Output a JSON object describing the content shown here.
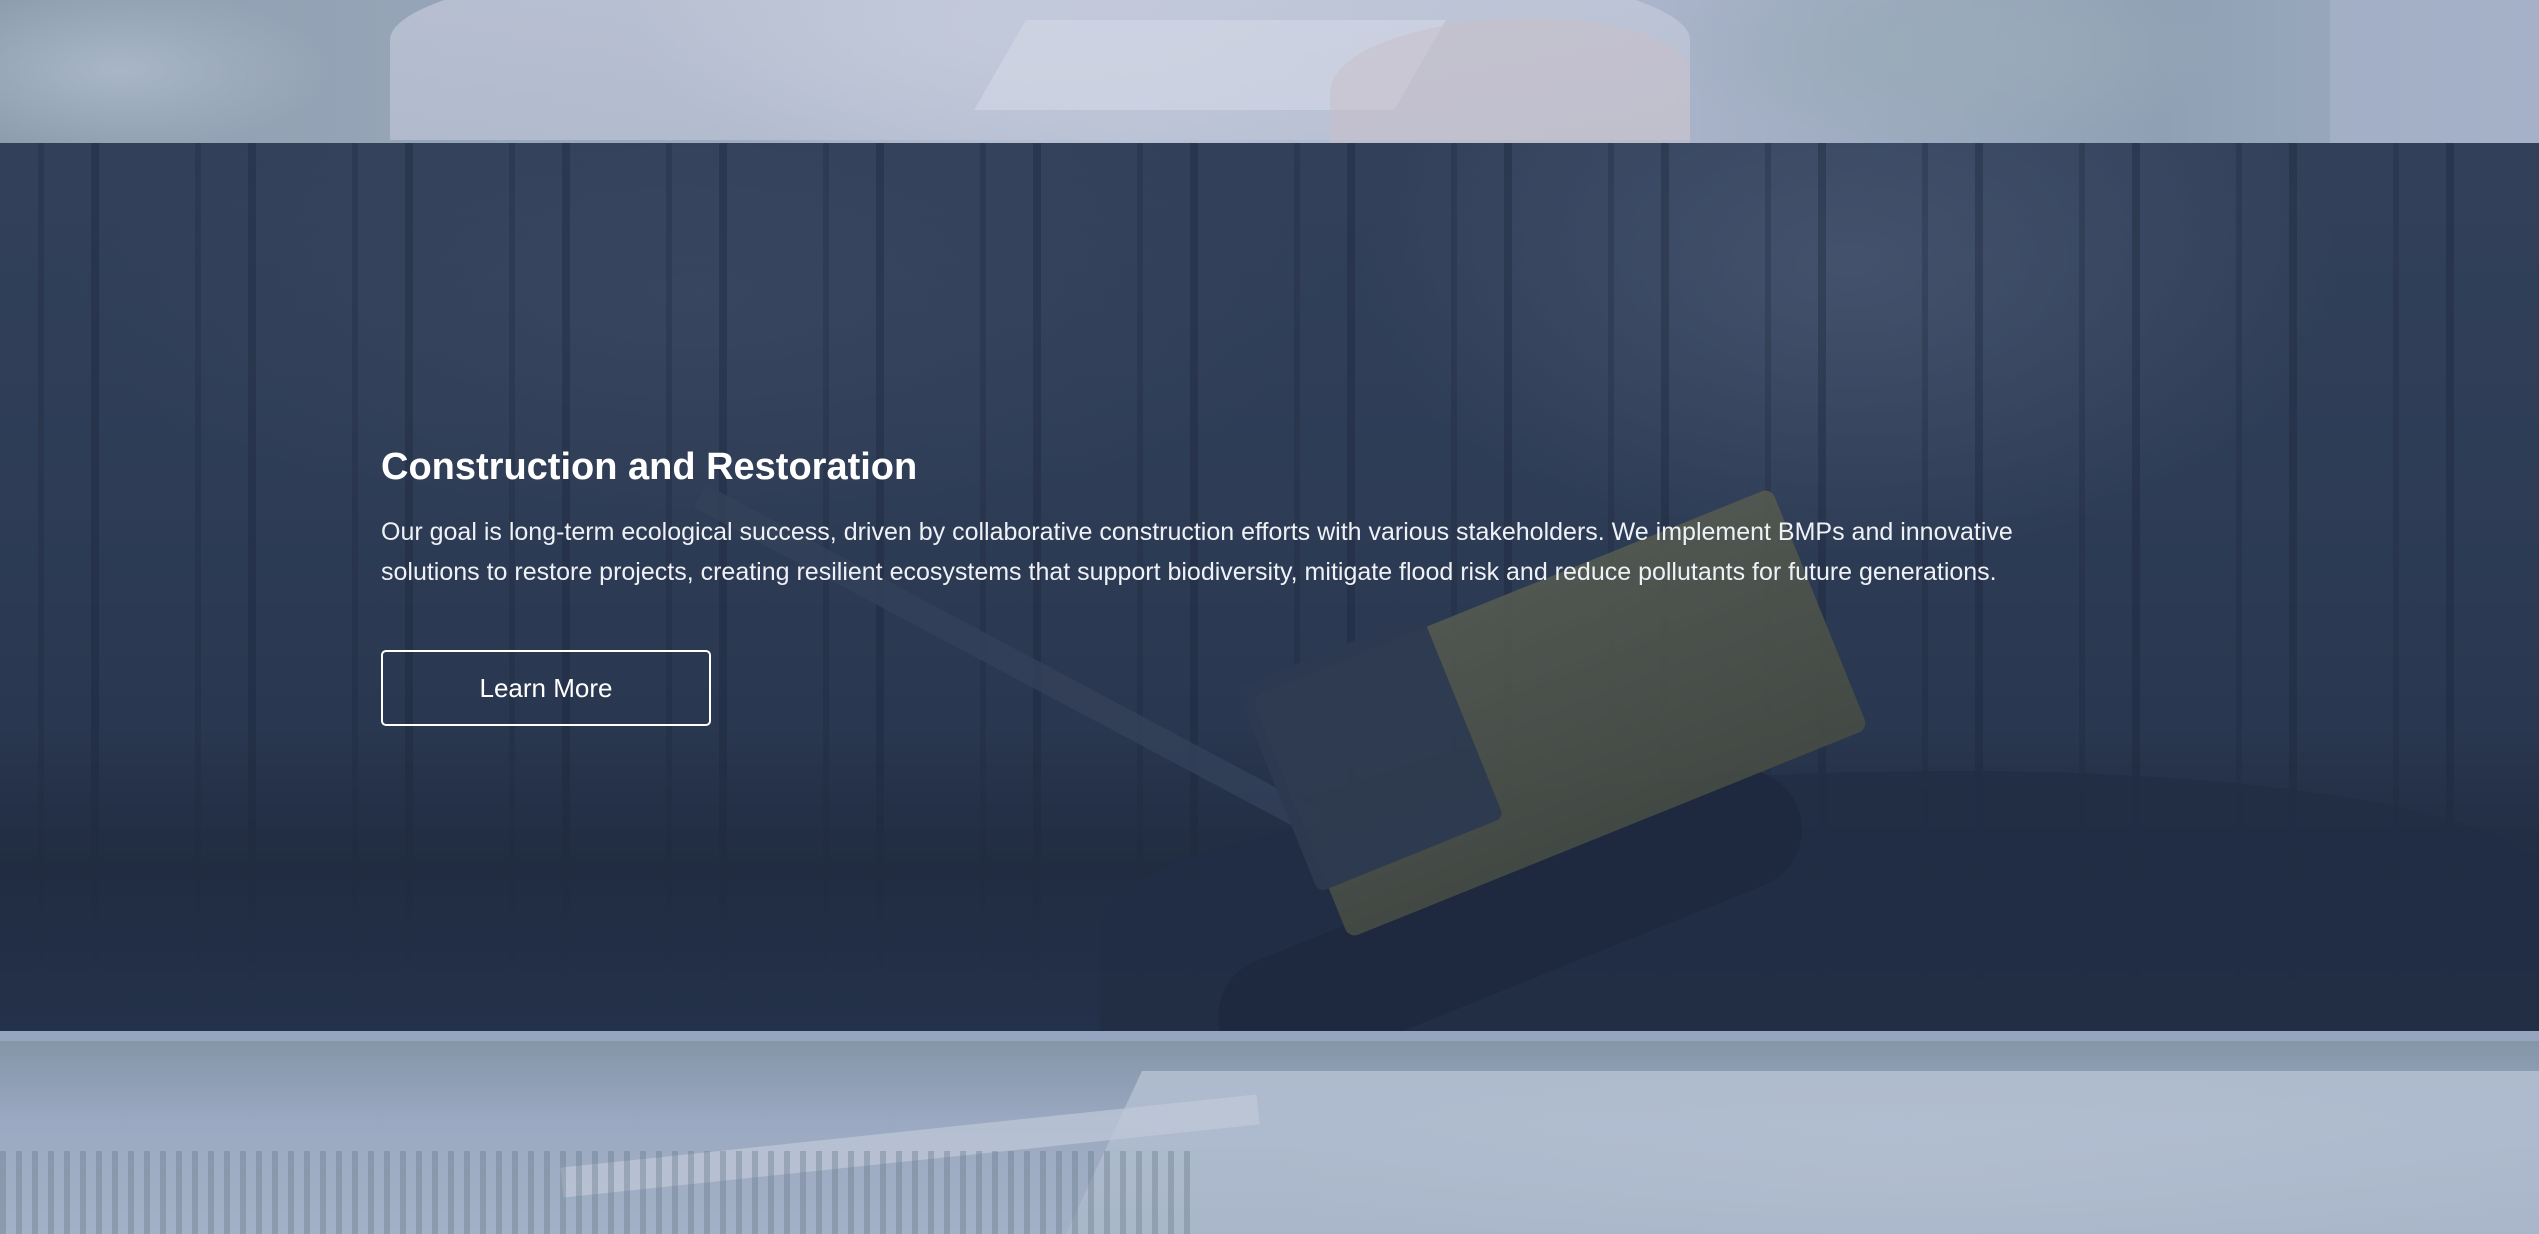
{
  "hero": {
    "title": "Construction and Restoration",
    "description": "Our goal is long-term ecological success, driven by collaborative construction efforts with various stakeholders. We implement BMPs and innovative solutions to restore projects, creating resilient ecosystems that support biodiversity, mitigate flood risk and reduce pollutants for future generations.",
    "button_label": "Learn More"
  },
  "colors": {
    "hero_overlay": "#2a3850",
    "text": "#ffffff",
    "button_border": "#ffffff",
    "faded_sections": "#95a4bf"
  }
}
